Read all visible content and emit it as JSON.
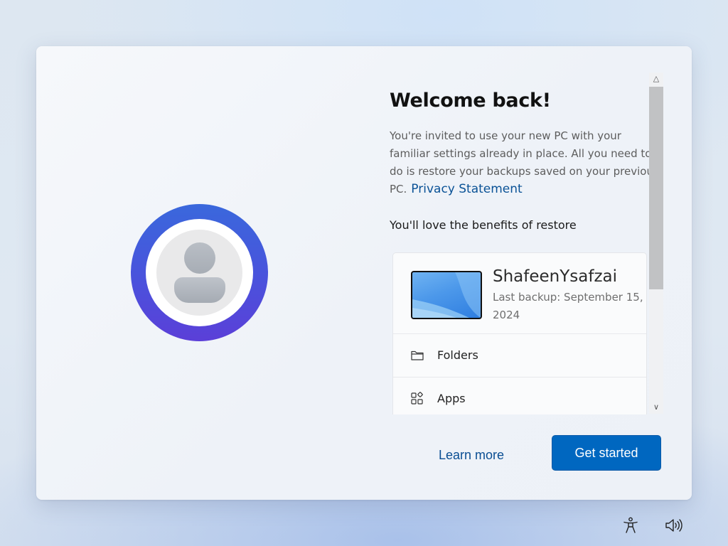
{
  "welcome": {
    "title": "Welcome back!",
    "description": "You're invited to use your new PC with your familiar settings already in place. All you need to do is restore your backups saved on your previous PC.",
    "privacy_link": "Privacy Statement",
    "benefits_heading": "You'll love the benefits of restore"
  },
  "backup": {
    "device_name": "ShafeenYsafzai",
    "last_backup": "Last backup: September 15, 2024",
    "items": [
      {
        "label": "Folders",
        "icon": "folder-icon"
      },
      {
        "label": "Apps",
        "icon": "apps-icon"
      }
    ]
  },
  "actions": {
    "learn_more": "Learn more",
    "get_started": "Get started"
  },
  "colors": {
    "accent": "#0067c0",
    "link": "#0a5296",
    "avatar_ring_start": "#3a68dc",
    "avatar_ring_end": "#5b3fd8"
  },
  "tray": {
    "icons": [
      "accessibility-icon",
      "volume-icon"
    ]
  }
}
